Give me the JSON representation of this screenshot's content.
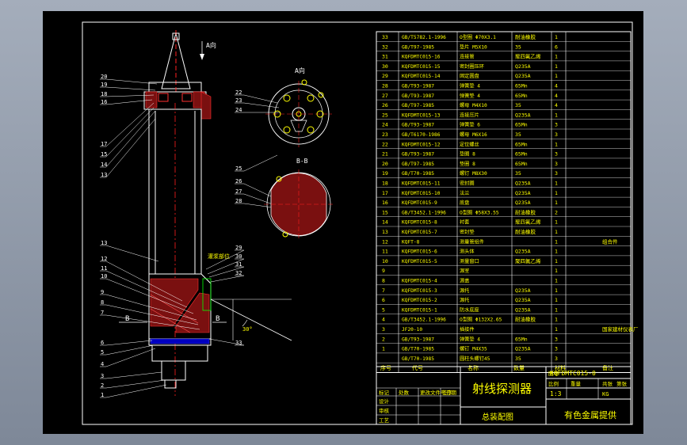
{
  "drawing": {
    "title": "射线探测器",
    "subtitle": "总装配图",
    "company": "有色金属提供",
    "drawing_no": "KQFDMTC015-0",
    "scale": "1:3",
    "weight": "KG",
    "section_a_label": "A向",
    "section_b_label": "B-B",
    "view_arrow_label": "A向",
    "cut_label_left": "B",
    "cut_label_right": "B",
    "angle_label": "30°",
    "annotation_right": "灌浆部位",
    "left_balloons": [
      "20",
      "19",
      "18",
      "16",
      "17",
      "15",
      "14",
      "13",
      "13",
      "12",
      "11",
      "10",
      "9",
      "8",
      "7",
      "6",
      "5",
      "4",
      "3",
      "2",
      "1"
    ],
    "mid_balloons": [
      "22",
      "23",
      "24",
      "25",
      "26",
      "27",
      "28",
      "29",
      "30",
      "31",
      "32",
      "33"
    ]
  },
  "bom_rows": [
    [
      "33",
      "GB/T5782.1-1996",
      "O型圈 Φ70X3.1",
      "耐油橡胶",
      "1",
      ""
    ],
    [
      "32",
      "GB/T97-1985",
      "垫片 M5X10",
      "35",
      "6",
      ""
    ],
    [
      "31",
      "KQFDMTC015-16",
      "连接管",
      "聚四氟乙烯",
      "1",
      ""
    ],
    [
      "30",
      "KQFDMTC015-15",
      "密封圈压环",
      "Q235A",
      "1",
      ""
    ],
    [
      "29",
      "KQFDMTC015-14",
      "固定圆盘",
      "Q235A",
      "1",
      ""
    ],
    [
      "28",
      "GB/T93-1987",
      "弹簧垫 4",
      "65Mn",
      "4",
      ""
    ],
    [
      "27",
      "GB/T93-1987",
      "弹簧垫 4",
      "65Mn",
      "4",
      ""
    ],
    [
      "26",
      "GB/T97-1985",
      "螺母 M4X10",
      "35",
      "4",
      ""
    ],
    [
      "25",
      "KQFDMTC015-13",
      "连接压片",
      "Q235A",
      "1",
      ""
    ],
    [
      "24",
      "GB/T93-1987",
      "弹簧垫 6",
      "65Mn",
      "3",
      ""
    ],
    [
      "23",
      "GB/T6170-1986",
      "螺母 M6X16",
      "35",
      "3",
      ""
    ],
    [
      "22",
      "KQFDMTC015-12",
      "定位螺丝",
      "65Mn",
      "1",
      ""
    ],
    [
      "21",
      "GB/T93-1987",
      "垫圈 8",
      "65Mn",
      "3",
      ""
    ],
    [
      "20",
      "GB/T97-1985",
      "垫圈 8",
      "65Mn",
      "3",
      ""
    ],
    [
      "19",
      "GB/T70-1985",
      "螺钉 M8X30",
      "35",
      "3",
      ""
    ],
    [
      "18",
      "KQFDMTC015-11",
      "密封圈",
      "Q235A",
      "1",
      ""
    ],
    [
      "17",
      "KQFDMTC015-10",
      "法兰",
      "Q235A",
      "1",
      ""
    ],
    [
      "16",
      "KQFDMTC015-9",
      "底盘",
      "Q235A",
      "1",
      ""
    ],
    [
      "15",
      "GB/T3452.1-1996",
      "O型圈 Φ58X3.55",
      "耐油橡胶",
      "2",
      ""
    ],
    [
      "14",
      "KQFDMTC015-8",
      "衬套",
      "聚四氟乙烯",
      "1",
      ""
    ],
    [
      "13",
      "KQFDMTC015-7",
      "密封垫",
      "耐油橡胶",
      "1",
      ""
    ],
    [
      "12",
      "KQFT-8",
      "测量管组件",
      "",
      "1",
      "组合件"
    ],
    [
      "11",
      "KQFDMTC015-6",
      "测头体",
      "Q235A",
      "1",
      ""
    ],
    [
      "10",
      "KQFDMTC015-5",
      "测量窗口",
      "聚四氟乙烯",
      "1",
      ""
    ],
    [
      "9",
      "",
      "源室",
      "",
      "1",
      ""
    ],
    [
      "8",
      "KQFDMTC015-4",
      "源盖",
      "",
      "1",
      ""
    ],
    [
      "7",
      "KQFDMTC015-3",
      "源托",
      "Q235A",
      "1",
      ""
    ],
    [
      "6",
      "KQFDMTC015-2",
      "源托",
      "Q235A",
      "1",
      ""
    ],
    [
      "5",
      "KQFDMTC015-1",
      "防水底座",
      "Q235A",
      "1",
      ""
    ],
    [
      "4",
      "GB/T3452.1-1996",
      "O型圈 Φ132X2.65",
      "耐油橡胶",
      "1",
      ""
    ],
    [
      "3",
      "JF20-10",
      "插接件",
      "",
      "1",
      "国家建材仪表厂"
    ],
    [
      "2",
      "GB/T93-1987",
      "弹簧垫 4",
      "65Mn",
      "3",
      ""
    ],
    [
      "1",
      "GB/T70-1985",
      "螺钉 M4X35",
      "Q235A",
      "3",
      ""
    ],
    [
      "",
      "GB/T70-1985",
      "圆柱头螺钉45",
      "35",
      "3",
      ""
    ]
  ],
  "bom_header": [
    "序号",
    "代号",
    "名称",
    "数量",
    "材料",
    "备注"
  ],
  "title_block": {
    "labels_left": [
      "标记",
      "处数",
      "更改文件号",
      "签字",
      "日期",
      "设计",
      "审核",
      "工艺"
    ],
    "labels_right": [
      "图号",
      "重量",
      "比例",
      "共张",
      "第张"
    ]
  }
}
